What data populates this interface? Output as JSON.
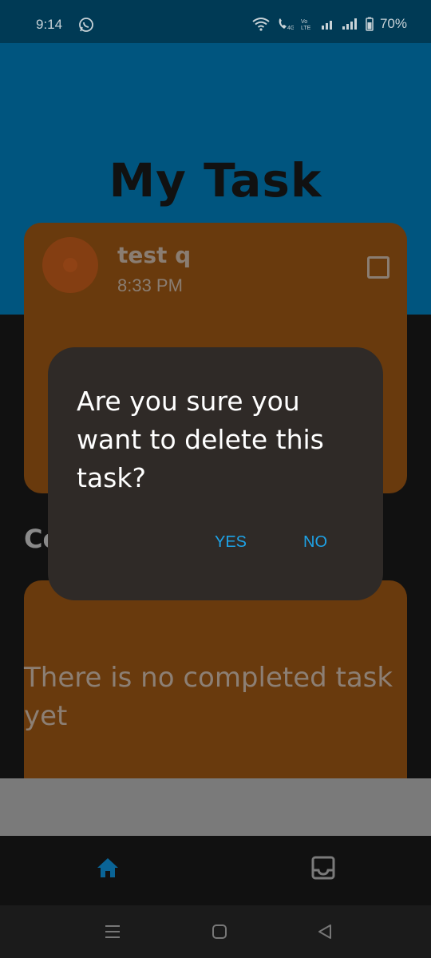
{
  "status_bar": {
    "time": "9:14",
    "battery": "70%"
  },
  "page": {
    "title": "My Task"
  },
  "task": {
    "title": "test q",
    "time": "8:33 PM"
  },
  "completed_section": {
    "heading": "Completed",
    "empty_message": "There is no completed task yet"
  },
  "dialog": {
    "message": "Are you sure you want to delete this task?",
    "yes_label": "YES",
    "no_label": "NO"
  },
  "nav": {
    "items": [
      {
        "icon": "home-icon",
        "active": true
      },
      {
        "icon": "inbox-icon",
        "active": false
      }
    ]
  },
  "colors": {
    "header": "#00557f",
    "card": "#693a0d",
    "dialog": "#2f2a27",
    "accent": "#1ea2e6",
    "active_nav": "#0a6496"
  }
}
